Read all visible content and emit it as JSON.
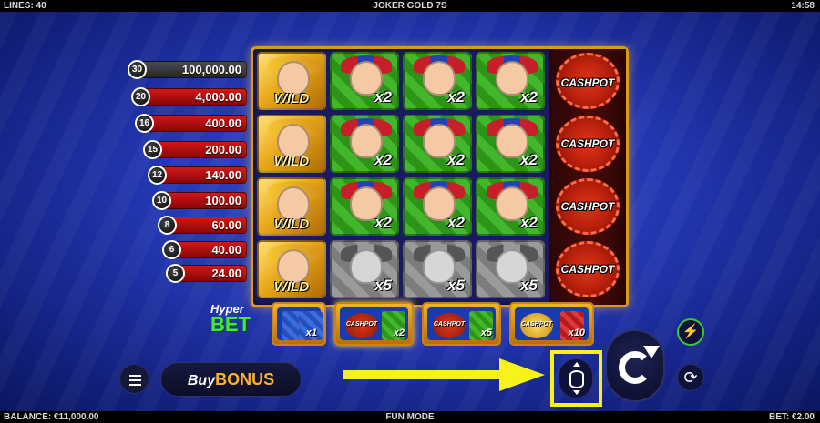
{
  "topbar": {
    "lines": "LINES: 40",
    "title": "JOKER GOLD 7S",
    "time": "14:58"
  },
  "bottombar": {
    "balance": "BALANCE: €11,000.00",
    "mode": "FUN MODE",
    "bet": "BET: €2.00"
  },
  "jackpot_ladder": [
    {
      "count": "30",
      "value": "100,000.00"
    },
    {
      "count": "20",
      "value": "4,000.00"
    },
    {
      "count": "16",
      "value": "400.00"
    },
    {
      "count": "15",
      "value": "200.00"
    },
    {
      "count": "12",
      "value": "140.00"
    },
    {
      "count": "10",
      "value": "100.00"
    },
    {
      "count": "8",
      "value": "60.00"
    },
    {
      "count": "6",
      "value": "40.00"
    },
    {
      "count": "5",
      "value": "24.00"
    }
  ],
  "reels": {
    "rows": [
      [
        "WILD",
        "x2",
        "x2",
        "x2",
        "CASHPOT"
      ],
      [
        "WILD",
        "x2",
        "x2",
        "x2",
        "CASHPOT"
      ],
      [
        "WILD",
        "x2",
        "x2",
        "x2",
        "CASHPOT"
      ],
      [
        "WILD",
        "x5",
        "x5",
        "x5",
        "CASHPOT"
      ]
    ]
  },
  "hyper_bet": {
    "title_top": "Hyper",
    "title_bottom": "BET",
    "options": [
      {
        "chip": "",
        "mult": "x1"
      },
      {
        "chip": "CASHPOT",
        "mult": "x2"
      },
      {
        "chip": "CASHPOT",
        "mult": "x5"
      },
      {
        "chip": "CASHPOT",
        "mult": "x10"
      }
    ]
  },
  "buy_bonus": {
    "prefix": "Buy",
    "label": "BONUS"
  },
  "colors": {
    "accent_yellow": "#f6f21a",
    "gold": "#d99a1c",
    "turbo_green": "#39c832",
    "ladder_red": "#d01818"
  }
}
